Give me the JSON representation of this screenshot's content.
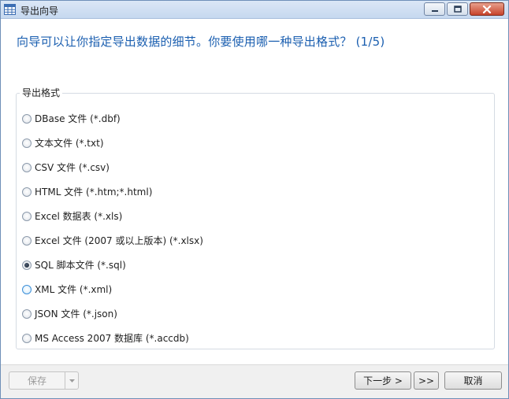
{
  "window": {
    "title": "导出向导",
    "icon": "table-grid-icon"
  },
  "heading": "向导可以让你指定导出数据的细节。你要使用哪一种导出格式？ (1/5)",
  "group": {
    "legend": "导出格式",
    "options": [
      {
        "label": "DBase 文件 (*.dbf)",
        "checked": false
      },
      {
        "label": "文本文件 (*.txt)",
        "checked": false
      },
      {
        "label": "CSV 文件 (*.csv)",
        "checked": false
      },
      {
        "label": "HTML 文件 (*.htm;*.html)",
        "checked": false
      },
      {
        "label": "Excel 数据表 (*.xls)",
        "checked": false
      },
      {
        "label": "Excel 文件 (2007 或以上版本) (*.xlsx)",
        "checked": false
      },
      {
        "label": "SQL 脚本文件 (*.sql)",
        "checked": true
      },
      {
        "label": "XML 文件 (*.xml)",
        "checked": false,
        "hover": true
      },
      {
        "label": "JSON 文件 (*.json)",
        "checked": false
      },
      {
        "label": "MS Access 2007 数据库 (*.accdb)",
        "checked": false
      }
    ]
  },
  "footer": {
    "save_label": "保存",
    "next_label": "下一步 >",
    "fast_forward_label": ">>",
    "cancel_label": "取消"
  },
  "colors": {
    "heading": "#1b5fb0",
    "close_button": "#c7432b"
  }
}
